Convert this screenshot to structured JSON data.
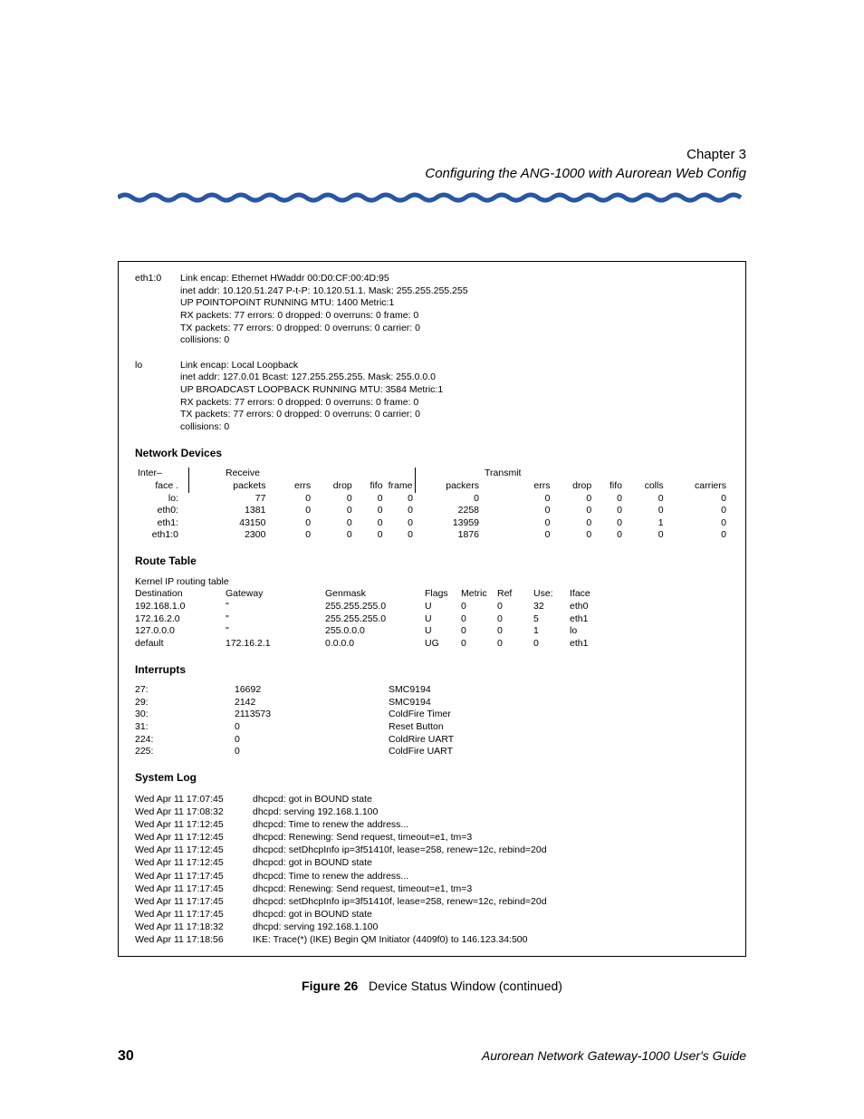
{
  "header": {
    "chapter": "Chapter 3",
    "subtitle": "Configuring the ANG-1000 with Aurorean Web Config"
  },
  "interfaces": [
    {
      "name": "eth1:0",
      "detail": "Link encap: Ethernet HWaddr 00:D0:CF:00:4D:95\ninet addr: 10.120.51.247 P-t-P: 10.120.51.1. Mask: 255.255.255.255\nUP POINTOPOINT RUNNING MTU: 1400 Metric:1\nRX packets: 77 errors: 0 dropped: 0 overruns: 0 frame: 0\nTX packets: 77 errors: 0 dropped: 0 overruns: 0 carrier: 0\ncollisions: 0"
    },
    {
      "name": "lo",
      "detail": "Link encap: Local Loopback\ninet addr: 127.0.01 Bcast: 127.255.255.255. Mask: 255.0.0.0\nUP BROADCAST LOOPBACK RUNNING MTU: 3584 Metric:1\nRX packets: 77 errors: 0 dropped: 0 overruns: 0 frame: 0\nTX packets: 77 errors: 0 dropped: 0 overruns: 0 carrier: 0\ncollisions: 0"
    }
  ],
  "sections": {
    "netdev_title": "Network Devices",
    "route_title": "Route Table",
    "interrupts_title": "Interrupts",
    "syslog_title": "System Log"
  },
  "netdev": {
    "group_receive": "Receive",
    "group_transmit": "Transmit",
    "h_inter": "Inter–",
    "h_face": "face .",
    "h_packets": "packets",
    "h_errs": "errs",
    "h_drop": "drop",
    "h_fifo": "fifo",
    "h_frame": "frame",
    "h_packers": "packers",
    "h_colls": "colls",
    "h_carriers": "carriers",
    "rows": [
      {
        "iface": "lo:",
        "rp": "77",
        "re": "0",
        "rd": "0",
        "rf": "0",
        "rfr": "0",
        "tp": "0",
        "te": "0",
        "td": "0",
        "tf": "0",
        "tc": "0",
        "tcar": "0"
      },
      {
        "iface": "eth0:",
        "rp": "1381",
        "re": "0",
        "rd": "0",
        "rf": "0",
        "rfr": "0",
        "tp": "2258",
        "te": "0",
        "td": "0",
        "tf": "0",
        "tc": "0",
        "tcar": "0"
      },
      {
        "iface": "eth1:",
        "rp": "43150",
        "re": "0",
        "rd": "0",
        "rf": "0",
        "rfr": "0",
        "tp": "13959",
        "te": "0",
        "td": "0",
        "tf": "0",
        "tc": "1",
        "tcar": "0"
      },
      {
        "iface": "eth1:0",
        "rp": "2300",
        "re": "0",
        "rd": "0",
        "rf": "0",
        "rfr": "0",
        "tp": "1876",
        "te": "0",
        "td": "0",
        "tf": "0",
        "tc": "0",
        "tcar": "0"
      }
    ]
  },
  "route": {
    "pretitle": "Kernel IP routing table",
    "h": {
      "dest": "Destination",
      "gw": "Gateway",
      "mask": "Genmask",
      "flags": "Flags",
      "metric": "Metric",
      "ref": "Ref",
      "use": "Use:",
      "iface": "Iface"
    },
    "rows": [
      {
        "dest": "192.168.1.0",
        "gw": "\"",
        "mask": "255.255.255.0",
        "flags": "U",
        "metric": "0",
        "ref": "0",
        "use": "32",
        "iface": "eth0"
      },
      {
        "dest": "172.16.2.0",
        "gw": "\"",
        "mask": "255.255.255.0",
        "flags": "U",
        "metric": "0",
        "ref": "0",
        "use": "5",
        "iface": "eth1"
      },
      {
        "dest": "127.0.0.0",
        "gw": "\"",
        "mask": "255.0.0.0",
        "flags": "U",
        "metric": "0",
        "ref": "0",
        "use": "1",
        "iface": "lo"
      },
      {
        "dest": "default",
        "gw": "172.16.2.1",
        "mask": "0.0.0.0",
        "flags": "UG",
        "metric": "0",
        "ref": "0",
        "use": "0",
        "iface": "eth1"
      }
    ]
  },
  "interrupts": {
    "rows": [
      {
        "irq": "27:",
        "count": "16692",
        "name": "SMC9194"
      },
      {
        "irq": "29:",
        "count": "2142",
        "name": "SMC9194"
      },
      {
        "irq": "30:",
        "count": "2113573",
        "name": "ColdFire Timer"
      },
      {
        "irq": "31:",
        "count": "0",
        "name": "Reset Button"
      },
      {
        "irq": "224:",
        "count": "0",
        "name": "ColdRire UART"
      },
      {
        "irq": "225:",
        "count": "0",
        "name": "ColdFire UART"
      }
    ]
  },
  "syslog": [
    {
      "ts": "Wed Apr 11 17:07:45",
      "msg": "dhcpcd: got in BOUND state"
    },
    {
      "ts": "Wed Apr 11 17:08:32",
      "msg": "dhcpd: serving 192.168.1.100"
    },
    {
      "ts": "Wed Apr 11 17:12:45",
      "msg": "dhcpcd: Time to renew the address..."
    },
    {
      "ts": "Wed Apr 11 17:12:45",
      "msg": "dhcpcd: Renewing: Send request, timeout=e1, tm=3"
    },
    {
      "ts": "Wed Apr 11 17:12:45",
      "msg": "dhcpcd: setDhcpInfo ip=3f51410f, lease=258, renew=12c, rebind=20d"
    },
    {
      "ts": "Wed Apr 11 17:12:45",
      "msg": "dhcpcd: got in BOUND state"
    },
    {
      "ts": "Wed Apr 11 17:17:45",
      "msg": "dhcpcd: Time to renew the address..."
    },
    {
      "ts": "Wed Apr 11 17:17:45",
      "msg": "dhcpcd: Renewing: Send request, timeout=e1, tm=3"
    },
    {
      "ts": "Wed Apr 11 17:17:45",
      "msg": "dhcpcd: setDhcpInfo ip=3f51410f, lease=258, renew=12c, rebind=20d"
    },
    {
      "ts": "Wed Apr 11 17:17:45",
      "msg": "dhcpcd: got in BOUND state"
    },
    {
      "ts": "Wed Apr 11 17:18:32",
      "msg": "dhcpd: serving 192.168.1.100"
    },
    {
      "ts": "Wed Apr 11 17:18:56",
      "msg": "IKE: Trace(*) (IKE) Begin QM Initiator (4409f0) to 146.123.34:500"
    }
  ],
  "caption": {
    "label": "Figure 26",
    "text": "Device Status Window (continued)"
  },
  "footer": {
    "page": "30",
    "guide": "Aurorean Network Gateway-1000 User's Guide"
  }
}
